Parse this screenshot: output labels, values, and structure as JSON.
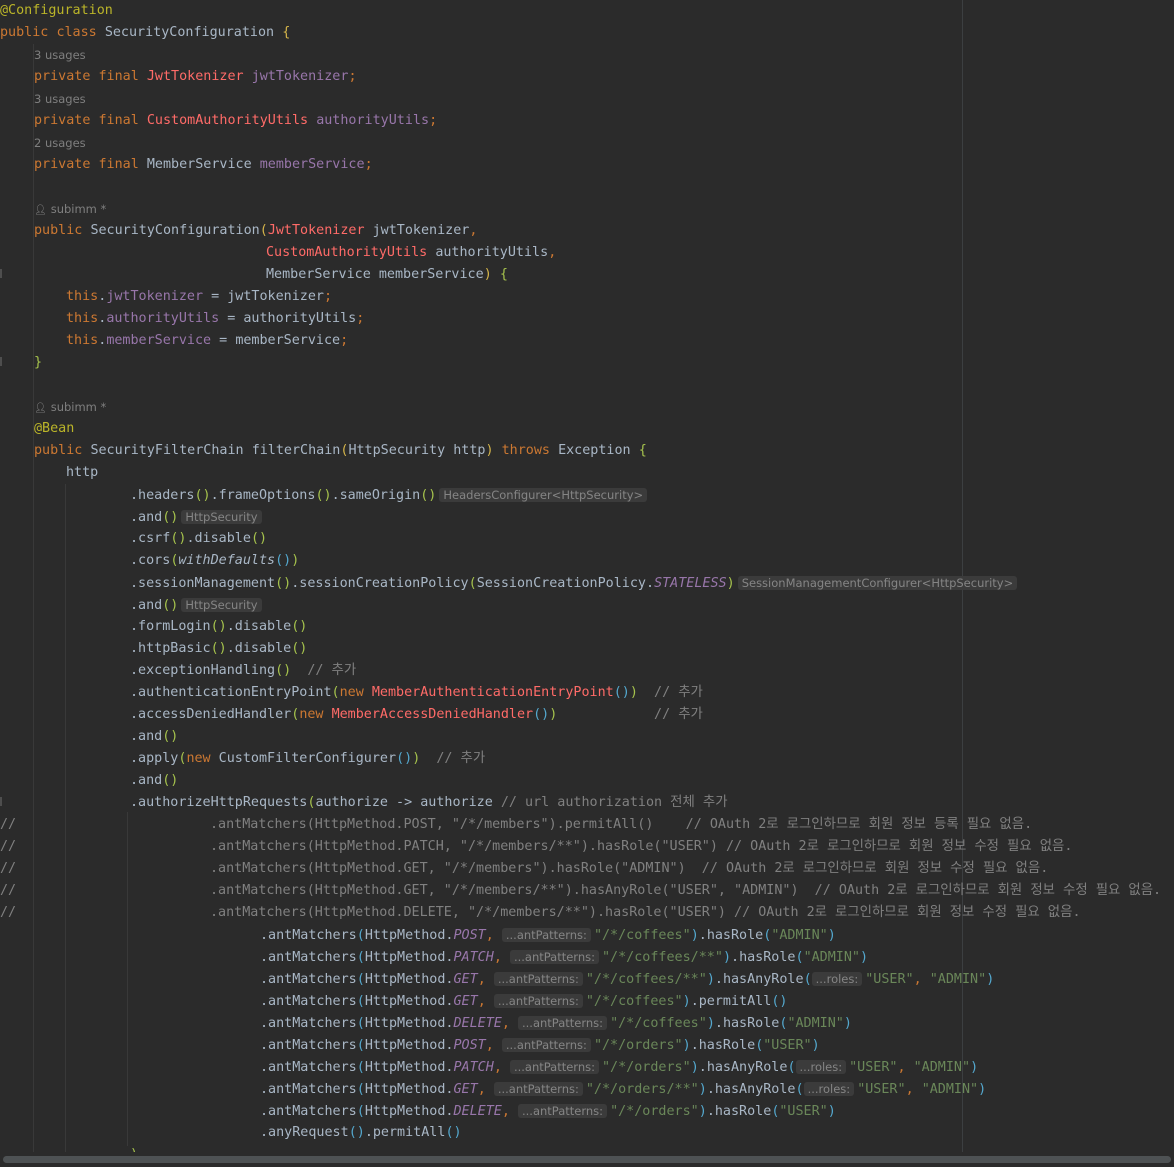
{
  "editor": {
    "annotation_configuration": "@Configuration",
    "kw_public": "public",
    "kw_class": "class",
    "kw_private": "private",
    "kw_final": "final",
    "kw_this": "this",
    "kw_new": "new",
    "kw_throws": "throws",
    "class_name": "SecurityConfiguration",
    "type_jwt": "JwtTokenizer",
    "type_authority": "CustomAuthorityUtils",
    "type_member_service": "MemberService",
    "field_jwt": "jwtTokenizer",
    "field_authority": "authorityUtils",
    "field_member_service": "memberService",
    "usages_3": "3 usages",
    "usages_2": "2 usages",
    "author": "subimm *",
    "annotation_bean": "@Bean",
    "type_filter_chain": "SecurityFilterChain",
    "method_filter_chain": "filterChain",
    "type_http_security": "HttpSecurity",
    "param_http": "http",
    "type_exception": "Exception",
    "hint_headers": "HeadersConfigurer<HttpSecurity>",
    "hint_http_security": "HttpSecurity",
    "hint_session": "SessionManagementConfigurer<HttpSecurity>",
    "hint_ant_patterns": "...antPatterns:",
    "hint_roles": "...roles:",
    "comment_add": "// 추가",
    "comment_authorize": "// url authorization 전체 추가",
    "commented_lines": [
      ".antMatchers(HttpMethod.POST, \"/*/members\").permitAll()    // OAuth 2로 로그인하므로 회원 정보 등록 필요 없음.",
      ".antMatchers(HttpMethod.PATCH, \"/*/members/**\").hasRole(\"USER\") // OAuth 2로 로그인하므로 회원 정보 수정 필요 없음.",
      ".antMatchers(HttpMethod.GET, \"/*/members\").hasRole(\"ADMIN\")  // OAuth 2로 로그인하므로 회원 정보 수정 필요 없음.",
      ".antMatchers(HttpMethod.GET, \"/*/members/**\").hasAnyRole(\"USER\", \"ADMIN\")  // OAuth 2로 로그인하므로 회원 정보 수정 필요 없음.",
      ".antMatchers(HttpMethod.DELETE, \"/*/members/**\").hasRole(\"USER\") // OAuth 2로 로그인하므로 회원 정보 수정 필요 없음."
    ],
    "matchers": [
      {
        "method": "POST",
        "path": "\"/*/coffees\"",
        "fn": "hasRole",
        "roles": [
          "\"ADMIN\""
        ]
      },
      {
        "method": "PATCH",
        "path": "\"/*/coffees/**\"",
        "fn": "hasRole",
        "roles": [
          "\"ADMIN\""
        ]
      },
      {
        "method": "GET",
        "path": "\"/*/coffees/**\"",
        "fn": "hasAnyRole",
        "roles": [
          "\"USER\"",
          "\"ADMIN\""
        ]
      },
      {
        "method": "GET",
        "path": "\"/*/coffees\"",
        "fn": "permitAll",
        "roles": []
      },
      {
        "method": "DELETE",
        "path": "\"/*/coffees\"",
        "fn": "hasRole",
        "roles": [
          "\"ADMIN\""
        ]
      },
      {
        "method": "POST",
        "path": "\"/*/orders\"",
        "fn": "hasRole",
        "roles": [
          "\"USER\""
        ]
      },
      {
        "method": "PATCH",
        "path": "\"/*/orders\"",
        "fn": "hasAnyRole",
        "roles": [
          "\"USER\"",
          "\"ADMIN\""
        ]
      },
      {
        "method": "GET",
        "path": "\"/*/orders/**\"",
        "fn": "hasAnyRole",
        "roles": [
          "\"USER\"",
          "\"ADMIN\""
        ]
      },
      {
        "method": "DELETE",
        "path": "\"/*/orders\"",
        "fn": "hasRole",
        "roles": [
          "\"USER\""
        ]
      }
    ],
    "line_comment_prefix": "//",
    "colors": {
      "background": "#2b2b2b",
      "keyword": "#cc7832",
      "annotation": "#bbb529",
      "field": "#9876aa",
      "method_decl": "#ffc66d",
      "string": "#6a8759",
      "comment": "#808080",
      "error_type": "#ff6b68"
    }
  }
}
